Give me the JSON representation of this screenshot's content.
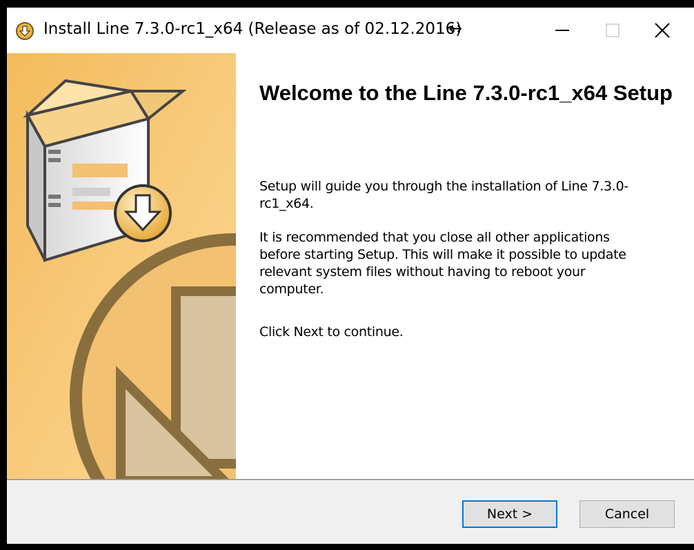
{
  "window": {
    "title": "Install Line 7.3.0-rc1_x64 (Release as of 02.12.2016)",
    "resize_glyph": "↔"
  },
  "welcome": {
    "title": "Welcome to the Line 7.3.0-rc1_x64 Setup",
    "paragraph1": "Setup will guide you through the installation of Line 7.3.0-rc1_x64.",
    "paragraph2": "It is recommended that you close all other applications before starting Setup. This will make it possible to update relevant system files without having to reboot your computer.",
    "paragraph3": "Click Next to continue."
  },
  "buttons": {
    "next": "Next >",
    "cancel": "Cancel"
  },
  "icons": {
    "app": "installer-icon",
    "minimize": "minimize-icon",
    "maximize": "maximize-icon",
    "close": "close-icon",
    "banner": "installer-banner-graphic"
  },
  "colors": {
    "banner_bg": "#f6c877",
    "focus_border": "#0078d7",
    "window_bg": "#f0f0f0"
  }
}
